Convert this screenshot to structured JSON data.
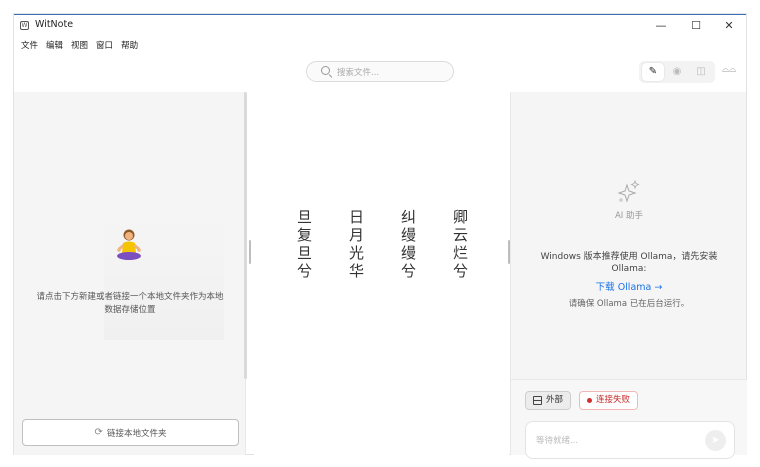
{
  "app": {
    "title": "WitNote"
  },
  "window_controls": {
    "minimize": "—",
    "maximize": "☐",
    "close": "✕"
  },
  "menu": [
    "文件",
    "编辑",
    "视图",
    "窗口",
    "帮助"
  ],
  "search": {
    "placeholder": "搜索文件..."
  },
  "view_modes": {
    "edit": "✎",
    "preview": "◉",
    "split": "◫",
    "reader": "⌓⌓"
  },
  "left_panel": {
    "empty_message_line1": "请点击下方新建或者链接一个本地文件夹作为本地",
    "empty_message_line2": "数据存储位置",
    "link_folder_button": "链接本地文件夹"
  },
  "poem": {
    "columns": [
      [
        "卿",
        "云",
        "烂",
        "兮"
      ],
      [
        "纠",
        "缦",
        "缦",
        "兮"
      ],
      [
        "日",
        "月",
        "光",
        "华"
      ],
      [
        "旦",
        "复",
        "旦",
        "兮"
      ]
    ]
  },
  "ai_panel": {
    "title": "AI 助手",
    "message": "Windows 版本推荐使用 Ollama，请先安装 Ollama:",
    "download_link": "下载 Ollama →",
    "note": "请确保 Ollama 已在后台运行。",
    "external_chip": "外部",
    "status_chip": "连接失败",
    "status_color": "#d32f2f",
    "input_placeholder": "等待就绪..."
  }
}
